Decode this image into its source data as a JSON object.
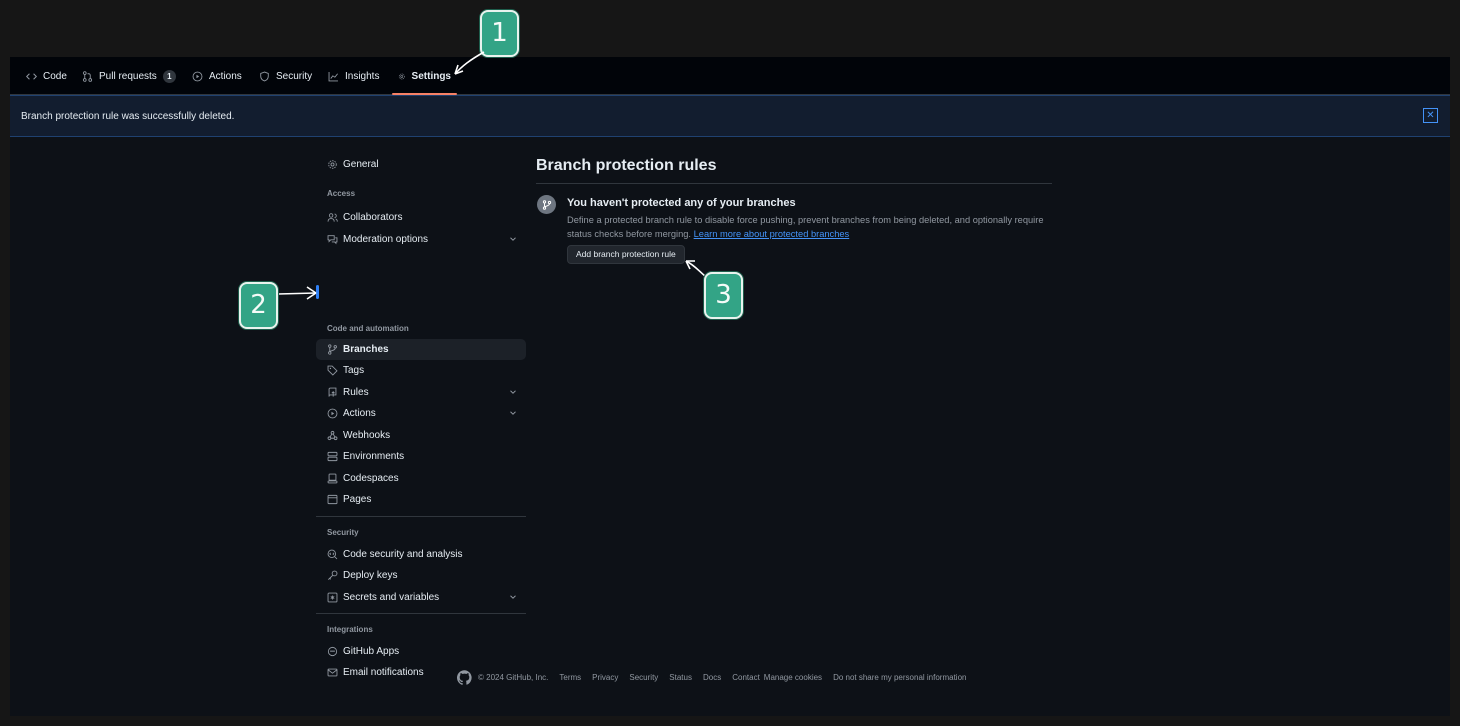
{
  "nav": {
    "tabs": [
      {
        "label": "Code",
        "icon": "code-icon"
      },
      {
        "label": "Pull requests",
        "icon": "pull-request-icon",
        "count": "1"
      },
      {
        "label": "Actions",
        "icon": "play-icon"
      },
      {
        "label": "Security",
        "icon": "shield-icon"
      },
      {
        "label": "Insights",
        "icon": "graph-icon"
      },
      {
        "label": "Settings",
        "icon": "gear-icon",
        "active": true
      }
    ]
  },
  "flash": {
    "message": "Branch protection rule was successfully deleted.",
    "close_label": "✕"
  },
  "sidebar": {
    "general": "General",
    "access_heading": "Access",
    "collaborators": "Collaborators",
    "moderation": "Moderation options",
    "code_heading": "Code and automation",
    "branches": "Branches",
    "tags": "Tags",
    "rules": "Rules",
    "actions": "Actions",
    "webhooks": "Webhooks",
    "environments": "Environments",
    "codespaces": "Codespaces",
    "pages": "Pages",
    "security_heading": "Security",
    "code_security": "Code security and analysis",
    "deploy_keys": "Deploy keys",
    "secrets": "Secrets and variables",
    "integrations_heading": "Integrations",
    "github_apps": "GitHub Apps",
    "email_notifications": "Email notifications"
  },
  "main": {
    "title": "Branch protection rules",
    "blank_title": "You haven't protected any of your branches",
    "blank_desc": "Define a protected branch rule to disable force pushing, prevent branches from being deleted, and optionally require status checks before merging.",
    "learn_more": "Learn more about protected branches",
    "add_rule_button": "Add branch protection rule"
  },
  "footer": {
    "copyright": "© 2024 GitHub, Inc.",
    "links": [
      "Terms",
      "Privacy",
      "Security",
      "Status",
      "Docs",
      "Contact",
      "Manage cookies",
      "Do not share my personal information"
    ]
  },
  "callouts": [
    "1",
    "2",
    "3"
  ],
  "colors": {
    "accent": "#2f81f7",
    "active_tab_underline": "#f78166",
    "callout_fill": "#33a486",
    "link": "#4493f8"
  }
}
